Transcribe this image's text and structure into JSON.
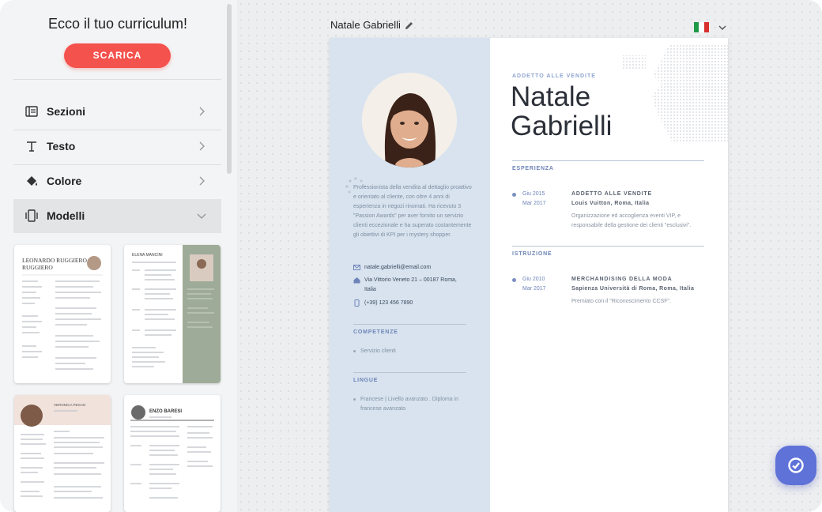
{
  "sidebar": {
    "title": "Ecco il tuo curriculum!",
    "download_label": "SCARICA",
    "menu": [
      {
        "label": "Sezioni",
        "icon": "sections-icon"
      },
      {
        "label": "Testo",
        "icon": "text-icon"
      },
      {
        "label": "Colore",
        "icon": "paint-bucket-icon"
      },
      {
        "label": "Modelli",
        "icon": "templates-icon",
        "expanded": true
      }
    ],
    "templates": [
      {
        "name": "LEONARDO RUGGIERO"
      },
      {
        "name": "ELENA MANCINI"
      },
      {
        "name": "VERONICA PEGAN"
      },
      {
        "name": "ENZO BARESI"
      }
    ]
  },
  "canvas": {
    "document_name": "Natale Gabrielli",
    "language_flag": "italian-flag",
    "colors": {
      "accent": "#f4524d",
      "left_column": "#d8e3ef",
      "heading": "#6e84b8",
      "fab": "#5f72d8"
    }
  },
  "resume": {
    "kicker": "ADDETTO ALLE VENDITE",
    "first_name": "Natale",
    "last_name": "Gabrielli",
    "summary": "Professionista della vendita al dettaglio proattivo e orientato al cliente, con oltre 4 anni di esperienza in negozi rinomati. Ha ricevuto 3 \"Passion Awards\" per aver fornito un servizio clienti eccezionale e ha superato costantemente gli obiettivi di KPI per i mystery shopper.",
    "contacts": [
      {
        "icon": "email-icon",
        "text": "natale.gabrielli@email.com"
      },
      {
        "icon": "home-icon",
        "text": "Via Vittorio Veneto 21 – 00187 Roma, Italia"
      },
      {
        "icon": "phone-icon",
        "text": "(+39) 123 456 7890"
      }
    ],
    "skills_heading": "COMPETENZE",
    "skills": [
      "Servizio clienti"
    ],
    "languages_heading": "LINGUE",
    "languages": [
      "Francese | Livello avanzato . Diploma in francese avanzato"
    ],
    "experience_heading": "ESPERIENZA",
    "experience": [
      {
        "start": "Giu 2015",
        "end": "Mar 2017",
        "title": "ADDETTO ALLE VENDITE",
        "org": "Louis Vuitton, Roma, Italia",
        "desc": "Organizzazione ed accoglienza eventi VIP, e responsabile della gestione dei clienti \"esclusivi\"."
      }
    ],
    "education_heading": "ISTRUZIONE",
    "education": [
      {
        "start": "Giu 2010",
        "end": "Mar 2017",
        "title": "MERCHANDISING DELLA MODA",
        "org": "Sapienza Università di Roma, Roma, Italia",
        "desc": "Premiato con il \"Riconoscimento CCSF\"."
      }
    ]
  }
}
